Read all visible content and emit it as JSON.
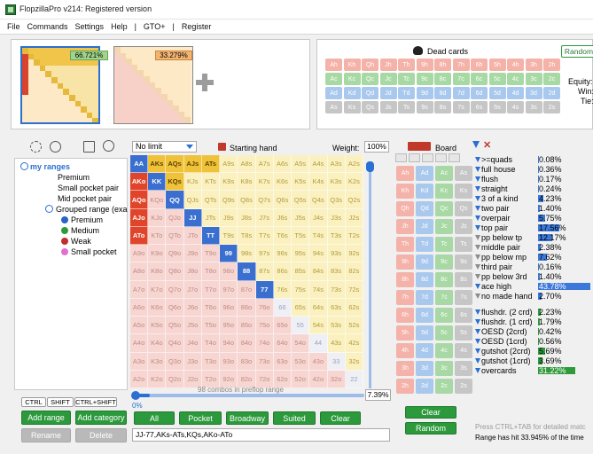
{
  "window": {
    "title": "FlopzillaPro v214: Registered version"
  },
  "menu": [
    "File",
    "Commands",
    "Settings",
    "Help",
    "|",
    "GTO+",
    "|",
    "Register"
  ],
  "thumbnails": [
    {
      "pct": "66.721%"
    },
    {
      "pct": "33.279%"
    }
  ],
  "dead_cards": {
    "label": "Dead cards",
    "random_label": "Random",
    "rows": [
      [
        "Ah",
        "Kh",
        "Qh",
        "Jh",
        "Th",
        "9h",
        "8h",
        "7h",
        "6h",
        "5h",
        "4h",
        "3h",
        "2h"
      ],
      [
        "Ac",
        "Kc",
        "Qc",
        "Jc",
        "Tc",
        "9c",
        "8c",
        "7c",
        "6c",
        "5c",
        "4c",
        "3c",
        "2c"
      ],
      [
        "Ad",
        "Kd",
        "Qd",
        "Jd",
        "Td",
        "9d",
        "8d",
        "7d",
        "6d",
        "5d",
        "4d",
        "3d",
        "2d"
      ],
      [
        "As",
        "Ks",
        "Qs",
        "Js",
        "Ts",
        "9s",
        "8s",
        "7s",
        "6s",
        "5s",
        "4s",
        "3s",
        "2s"
      ]
    ]
  },
  "equity": {
    "equity_label": "Equity:",
    "win_label": "Win:",
    "tie_label": "Tie:"
  },
  "tree": {
    "root": "my ranges",
    "items": [
      "Premium",
      "Small pocket pair",
      "Mid pocket pair"
    ],
    "group": "Grouped range (exa",
    "sub": [
      {
        "name": "Premium",
        "color": "#2a63c4"
      },
      {
        "name": "Medium",
        "color": "#2f9a3a"
      },
      {
        "name": "Weak",
        "color": "#c22d2d"
      },
      {
        "name": "Small pocket",
        "color": "#e070d6"
      }
    ]
  },
  "modifiers": [
    "CTRL",
    "SHIFT",
    "CTRL+SHIFT"
  ],
  "left_buttons": {
    "add_range": "Add range",
    "add_category": "Add category",
    "rename": "Rename",
    "delete": "Delete"
  },
  "range": {
    "limit": "No limit",
    "starting_hand": "Starting hand",
    "weight_label": "Weight:",
    "weight_value": "100%",
    "ranks": [
      "A",
      "K",
      "Q",
      "J",
      "T",
      "9",
      "8",
      "7",
      "6",
      "5",
      "4",
      "3",
      "2"
    ],
    "selected": [
      "AA",
      "KK",
      "QQ",
      "JJ",
      "TT",
      "99",
      "88",
      "77",
      "AKs",
      "AQs",
      "AJs",
      "ATs",
      "KQs",
      "AKo",
      "AQo",
      "AJo",
      "ATo"
    ],
    "combos_text": "98 combos in preflop range",
    "combos_pct": "7.39%",
    "slider_start": "0%",
    "text": "JJ-77,AKs-ATs,KQs,AKo-ATo",
    "buttons": [
      "All",
      "Pocket",
      "Broadway",
      "Suited",
      "Clear"
    ]
  },
  "board": {
    "label": "Board",
    "clear": "Clear",
    "random": "Random",
    "rows": [
      [
        "Ah",
        "Ad",
        "Ac",
        "As"
      ],
      [
        "Kh",
        "Kd",
        "Kc",
        "Ks"
      ],
      [
        "Qh",
        "Qd",
        "Qc",
        "Qs"
      ],
      [
        "Jh",
        "Jd",
        "Jc",
        "Js"
      ],
      [
        "Th",
        "Td",
        "Tc",
        "Ts"
      ],
      [
        "9h",
        "9d",
        "9c",
        "9s"
      ],
      [
        "8h",
        "8d",
        "8c",
        "8s"
      ],
      [
        "7h",
        "7d",
        "7c",
        "7s"
      ],
      [
        "6h",
        "6d",
        "6c",
        "6s"
      ],
      [
        "5h",
        "5d",
        "5c",
        "5s"
      ],
      [
        "4h",
        "4d",
        "4c",
        "4s"
      ],
      [
        "3h",
        "3d",
        "3c",
        "3s"
      ],
      [
        "2h",
        "2d",
        "2c",
        "2s"
      ]
    ]
  },
  "stats": [
    {
      "name": ">=quads",
      "pct": "0.08%",
      "v": 0.08,
      "c": "b",
      "bold": false
    },
    {
      "name": "full house",
      "pct": "0.36%",
      "v": 0.36,
      "c": "b",
      "bold": false
    },
    {
      "name": "flush",
      "pct": "0.17%",
      "v": 0.17,
      "c": "b",
      "bold": false
    },
    {
      "name": "straight",
      "pct": "0.24%",
      "v": 0.24,
      "c": "b",
      "bold": false
    },
    {
      "name": "3 of a kind",
      "pct": "4.23%",
      "v": 4.23,
      "c": "b",
      "bold": false
    },
    {
      "name": "two pair",
      "pct": "1.40%",
      "v": 1.4,
      "c": "b",
      "bold": false
    },
    {
      "name": "overpair",
      "pct": "5.75%",
      "v": 5.75,
      "c": "b",
      "bold": false
    },
    {
      "name": "top pair",
      "pct": "17.56%",
      "v": 17.56,
      "c": "b",
      "bold": false
    },
    {
      "name": "pp below tp",
      "pct": "12.17%",
      "v": 12.17,
      "c": "b",
      "bold": false
    },
    {
      "name": "middle pair",
      "pct": "2.38%",
      "v": 2.38,
      "c": "b",
      "bold": false
    },
    {
      "name": "pp below mp",
      "pct": "7.62%",
      "v": 7.62,
      "c": "b",
      "bold": false
    },
    {
      "name": "third pair",
      "pct": "0.16%",
      "v": 0.16,
      "c": "b",
      "bold": false
    },
    {
      "name": "pp below 3rd",
      "pct": "1.40%",
      "v": 1.4,
      "c": "b",
      "bold": false
    },
    {
      "name": "ace high",
      "pct": "43.78%",
      "v": 43.78,
      "c": "b",
      "bold": true
    },
    {
      "name": "no made hand",
      "pct": "2.70%",
      "v": 2.7,
      "c": "b",
      "bold": false
    },
    {
      "name": "flushdr. (2 crd)",
      "pct": "2.23%",
      "v": 2.23,
      "c": "g",
      "bold": false
    },
    {
      "name": "flushdr. (1 crd)",
      "pct": "1.79%",
      "v": 1.79,
      "c": "g",
      "bold": false
    },
    {
      "name": "OESD (2crd)",
      "pct": "0.42%",
      "v": 0.42,
      "c": "g",
      "bold": false
    },
    {
      "name": "OESD (1crd)",
      "pct": "0.56%",
      "v": 0.56,
      "c": "g",
      "bold": false
    },
    {
      "name": "gutshot (2crd)",
      "pct": "5.69%",
      "v": 5.69,
      "c": "g",
      "bold": false
    },
    {
      "name": "gutshot (1crd)",
      "pct": "3.69%",
      "v": 3.69,
      "c": "g",
      "bold": false
    },
    {
      "name": "overcards",
      "pct": "31.22%",
      "v": 31.22,
      "c": "g",
      "bold": true
    }
  ],
  "footer": {
    "hint": "Press CTRL+TAB for detailed matc",
    "hit": "Range has hit 33.945% of the time"
  },
  "colors": {
    "accent": "#2a6fd1",
    "green": "#2c9a3c"
  }
}
